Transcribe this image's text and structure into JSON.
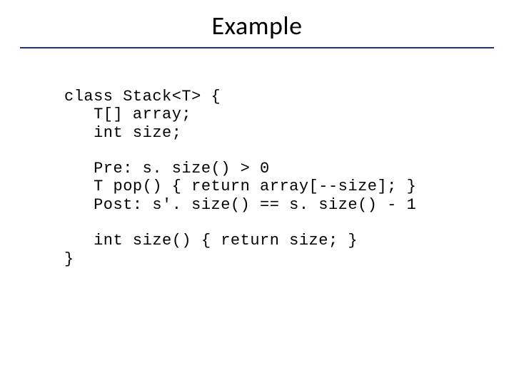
{
  "title": "Example",
  "code": {
    "l1": "class Stack<T> {",
    "l2": "   T[] array;",
    "l3": "   int size;",
    "l4": "",
    "l5": "   Pre: s. size() > 0",
    "l6": "   T pop() { return array[--size]; }",
    "l7": "   Post: s'. size() == s. size() - 1",
    "l8": "",
    "l9": "   int size() { return size; }",
    "l10": "}"
  }
}
